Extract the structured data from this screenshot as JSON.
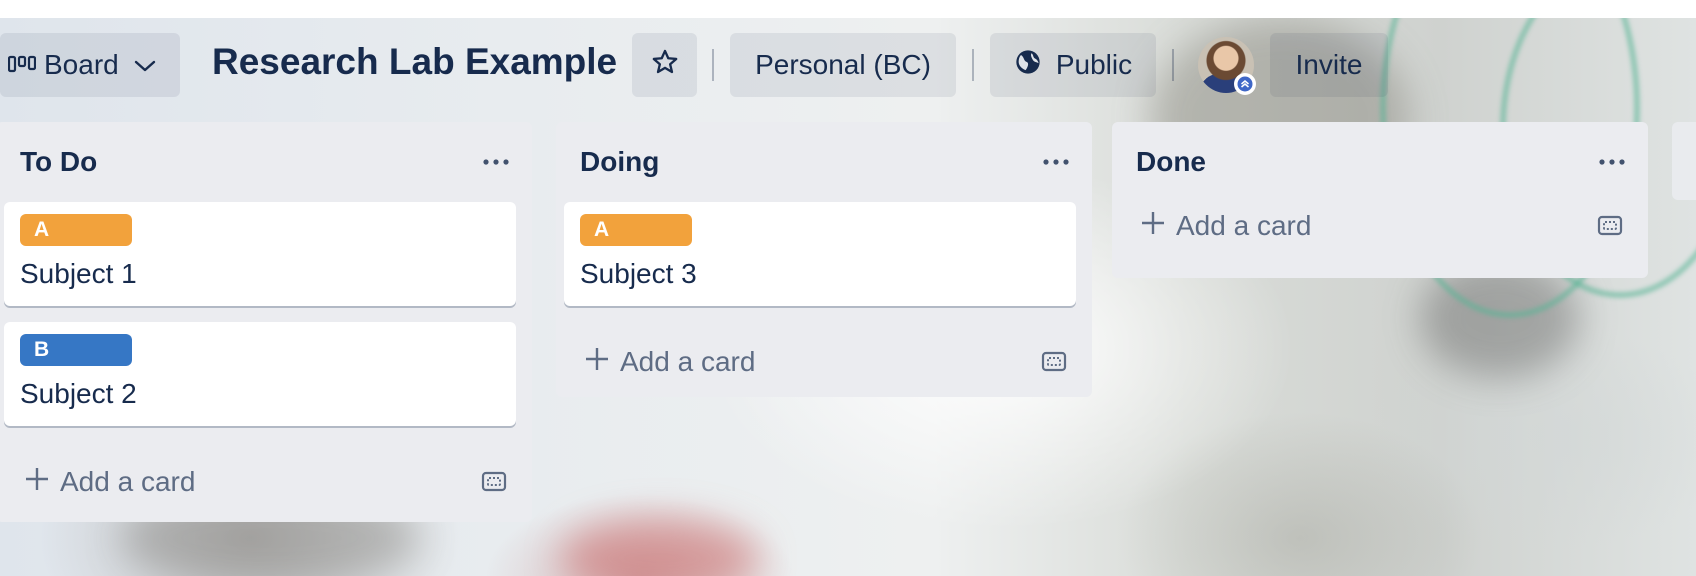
{
  "header": {
    "view_switcher_label": "Board",
    "board_title": "Research Lab Example",
    "workspace_label": "Personal (BC)",
    "visibility_label": "Public",
    "invite_label": "Invite"
  },
  "lists": [
    {
      "title": "To Do",
      "cards": [
        {
          "label": "A",
          "label_color": "#f2a23c",
          "title": "Subject 1"
        },
        {
          "label": "B",
          "label_color": "#3677c5",
          "title": "Subject 2"
        }
      ],
      "add_card_label": "Add a card"
    },
    {
      "title": "Doing",
      "cards": [
        {
          "label": "A",
          "label_color": "#f2a23c",
          "title": "Subject 3"
        }
      ],
      "add_card_label": "Add a card"
    },
    {
      "title": "Done",
      "cards": [],
      "add_card_label": "Add a card"
    }
  ],
  "colors": {
    "text_primary": "#172b4d",
    "text_subtle": "#5e6c84",
    "list_bg": "#ebecf0",
    "label_orange": "#f2a23c",
    "label_blue": "#3677c5"
  }
}
